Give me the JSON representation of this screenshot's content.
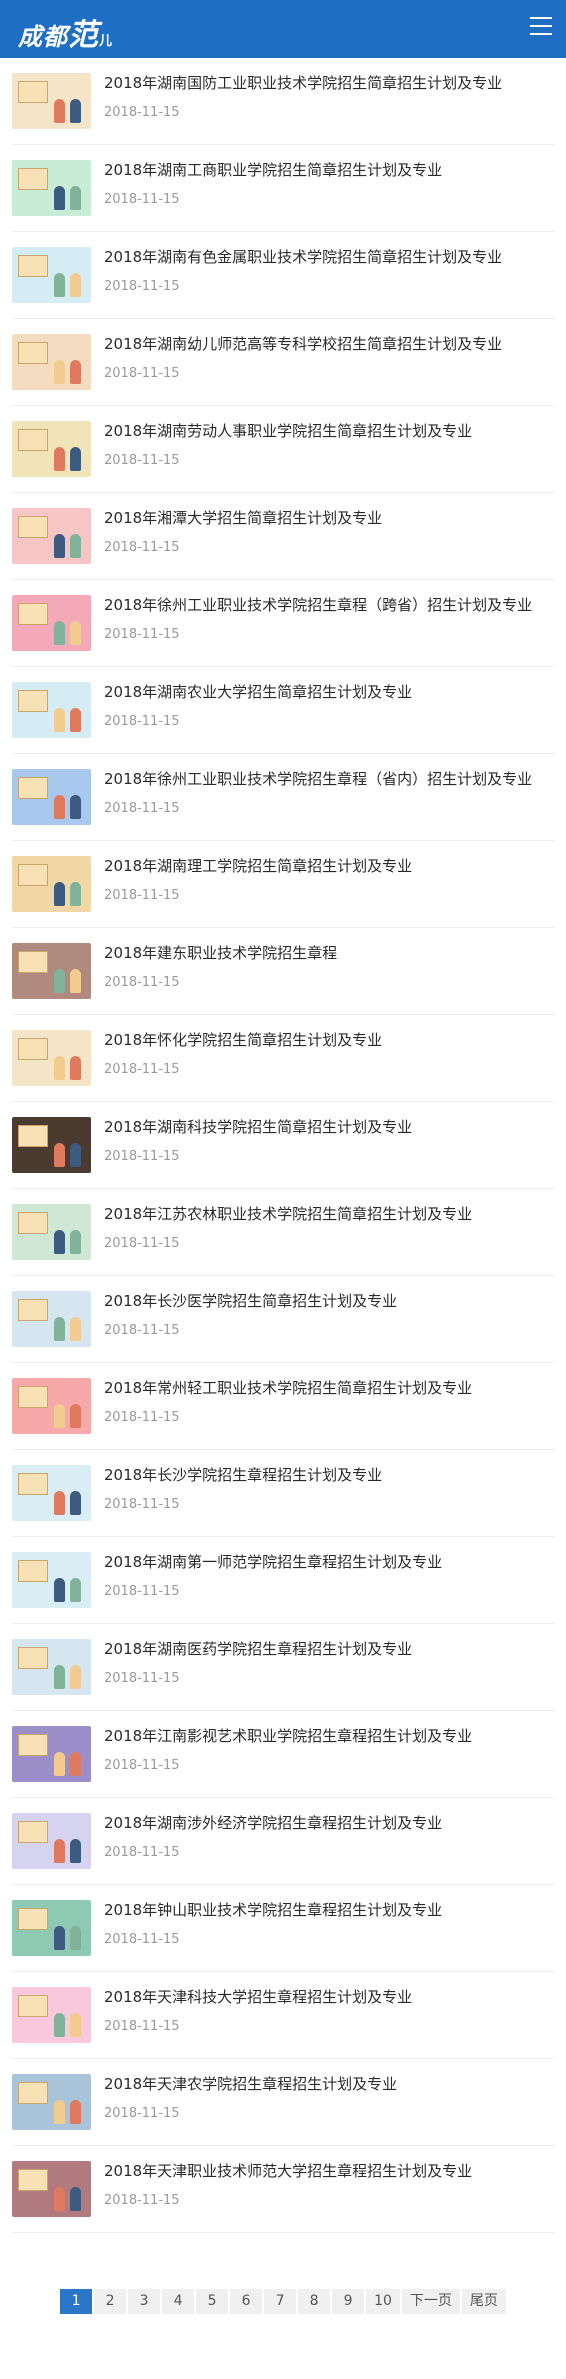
{
  "header": {
    "logo_main": "成都",
    "logo_big": "范",
    "logo_small": "儿"
  },
  "items": [
    {
      "title": "2018年湖南国防工业职业技术学院招生简章招生计划及专业",
      "date": "2018-11-15",
      "bg": "#f5e5c8"
    },
    {
      "title": "2018年湖南工商职业学院招生简章招生计划及专业",
      "date": "2018-11-15",
      "bg": "#c9ecd6"
    },
    {
      "title": "2018年湖南有色金属职业技术学院招生简章招生计划及专业",
      "date": "2018-11-15",
      "bg": "#d6ecf5"
    },
    {
      "title": "2018年湖南幼儿师范高等专科学校招生简章招生计划及专业",
      "date": "2018-11-15",
      "bg": "#f3dcc0"
    },
    {
      "title": "2018年湖南劳动人事职业学院招生简章招生计划及专业",
      "date": "2018-11-15",
      "bg": "#f0e4b8"
    },
    {
      "title": "2018年湘潭大学招生简章招生计划及专业",
      "date": "2018-11-15",
      "bg": "#f6c6c6"
    },
    {
      "title": "2018年徐州工业职业技术学院招生章程（跨省）招生计划及专业",
      "date": "2018-11-15",
      "bg": "#f3a9b8"
    },
    {
      "title": "2018年湖南农业大学招生简章招生计划及专业",
      "date": "2018-11-15",
      "bg": "#d5ecf5"
    },
    {
      "title": "2018年徐州工业职业技术学院招生章程（省内）招生计划及专业",
      "date": "2018-11-15",
      "bg": "#a8c8ee"
    },
    {
      "title": "2018年湖南理工学院招生简章招生计划及专业",
      "date": "2018-11-15",
      "bg": "#f2d7a6"
    },
    {
      "title": "2018年建东职业技术学院招生章程",
      "date": "2018-11-15",
      "bg": "#b08a7e"
    },
    {
      "title": "2018年怀化学院招生简章招生计划及专业",
      "date": "2018-11-15",
      "bg": "#f5e5c8"
    },
    {
      "title": "2018年湖南科技学院招生简章招生计划及专业",
      "date": "2018-11-15",
      "bg": "#4a3a30"
    },
    {
      "title": "2018年江苏农林职业技术学院招生简章招生计划及专业",
      "date": "2018-11-15",
      "bg": "#cfe8d6"
    },
    {
      "title": "2018年长沙医学院招生简章招生计划及专业",
      "date": "2018-11-15",
      "bg": "#d6e6f0"
    },
    {
      "title": "2018年常州轻工职业技术学院招生简章招生计划及专业",
      "date": "2018-11-15",
      "bg": "#f7a8a8"
    },
    {
      "title": "2018年长沙学院招生章程招生计划及专业",
      "date": "2018-11-15",
      "bg": "#d8eef4"
    },
    {
      "title": "2018年湖南第一师范学院招生章程招生计划及专业",
      "date": "2018-11-15",
      "bg": "#d8eef4"
    },
    {
      "title": "2018年湖南医药学院招生章程招生计划及专业",
      "date": "2018-11-15",
      "bg": "#d6e6f0"
    },
    {
      "title": "2018年江南影视艺术职业学院招生章程招生计划及专业",
      "date": "2018-11-15",
      "bg": "#9b8ec9"
    },
    {
      "title": "2018年湖南涉外经济学院招生章程招生计划及专业",
      "date": "2018-11-15",
      "bg": "#d5d3f0"
    },
    {
      "title": "2018年钟山职业技术学院招生章程招生计划及专业",
      "date": "2018-11-15",
      "bg": "#8ec9b4"
    },
    {
      "title": "2018年天津科技大学招生章程招生计划及专业",
      "date": "2018-11-15",
      "bg": "#f8c8dc"
    },
    {
      "title": "2018年天津农学院招生章程招生计划及专业",
      "date": "2018-11-15",
      "bg": "#a9c4d8"
    },
    {
      "title": "2018年天津职业技术师范大学招生章程招生计划及专业",
      "date": "2018-11-15",
      "bg": "#b07a7e"
    }
  ],
  "pager": [
    "1",
    "2",
    "3",
    "4",
    "5",
    "6",
    "7",
    "8",
    "9",
    "10",
    "下一页",
    "尾页"
  ],
  "colors": {
    "header": "#1e6fc4",
    "active_page": "#2a77c9"
  }
}
